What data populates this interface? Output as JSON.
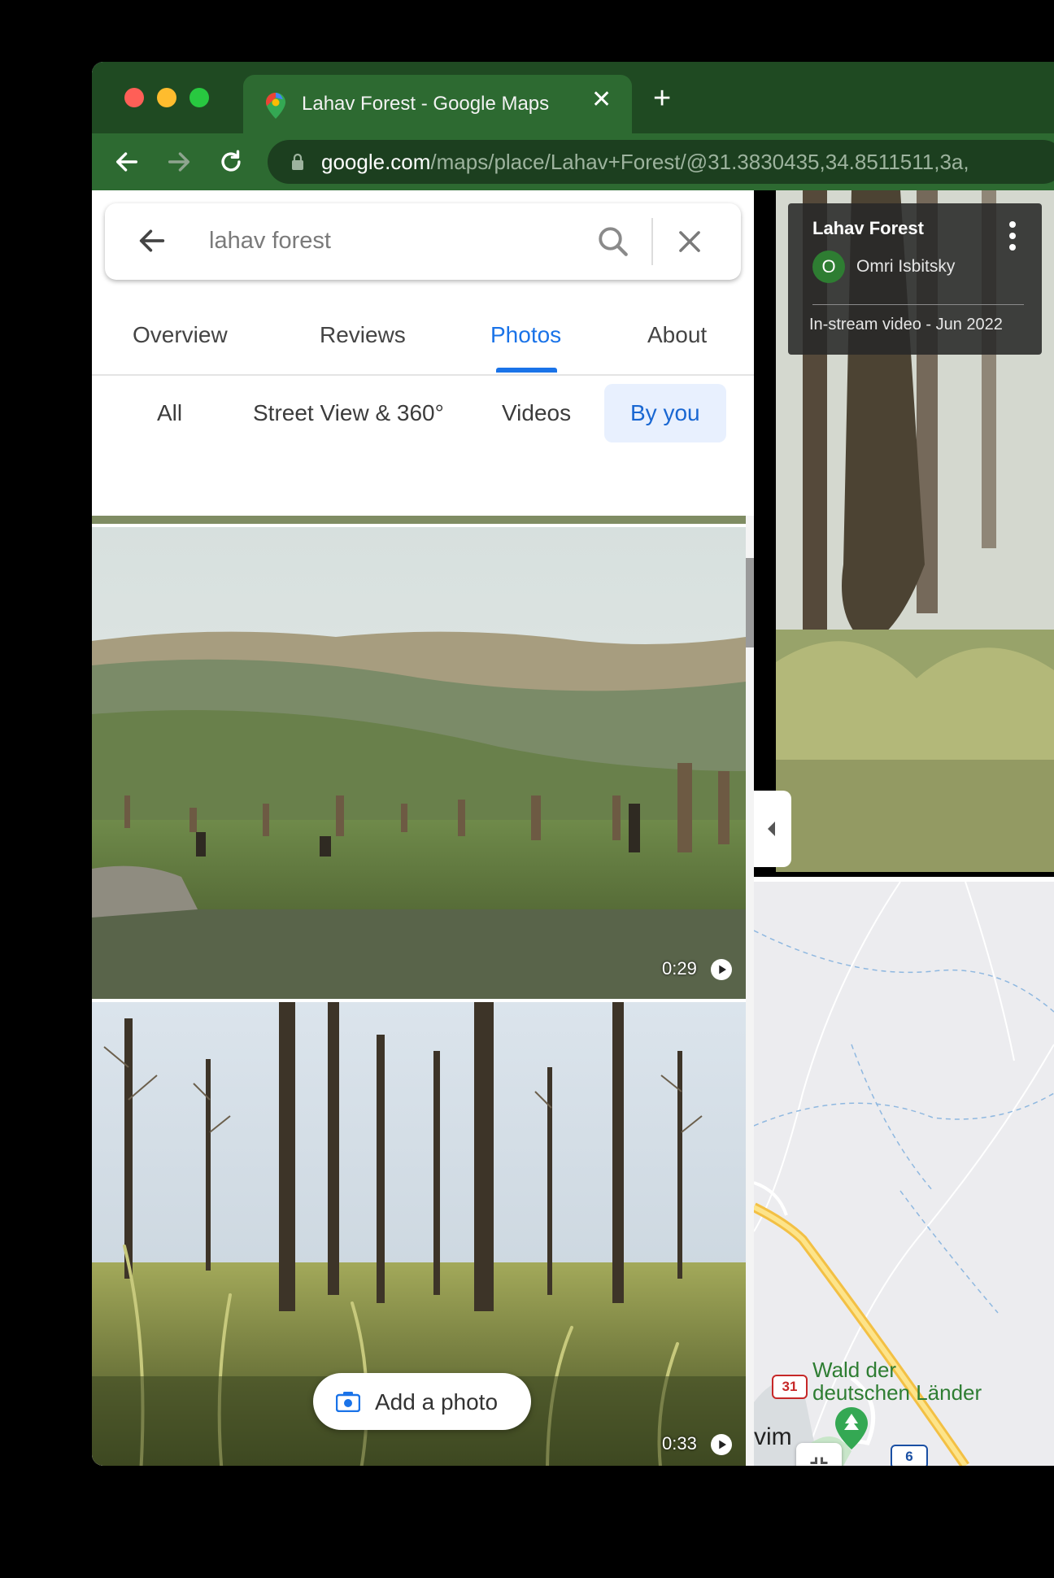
{
  "browser": {
    "tab_title": "Lahav Forest - Google Maps",
    "url_host": "google.com",
    "url_path": "/maps/place/Lahav+Forest/@31.3830435,34.8511511,3a,"
  },
  "search": {
    "value": "lahav forest"
  },
  "place_tabs": {
    "overview": "Overview",
    "reviews": "Reviews",
    "photos": "Photos",
    "about": "About"
  },
  "filter_chips": {
    "all": "All",
    "street_view": "Street View & 360°",
    "videos": "Videos",
    "by_you": "By you"
  },
  "photos": [
    {
      "duration": "0:29"
    },
    {
      "duration": "0:33"
    }
  ],
  "add_photo_label": "Add a photo",
  "viewer": {
    "place_title": "Lahav Forest",
    "author_initial": "O",
    "author_name": "Omri Isbitsky",
    "meta": "In-stream video - Jun 2022"
  },
  "map": {
    "poi_label_line1": "Wald der",
    "poi_label_line2": "deutschen Länder",
    "town_fragment": "vim",
    "route_red": "31",
    "route_blue": "6"
  },
  "colors": {
    "accent": "#1a73e8",
    "chrome_green": "#2d6a31",
    "map_park_green": "#2e7d32"
  }
}
